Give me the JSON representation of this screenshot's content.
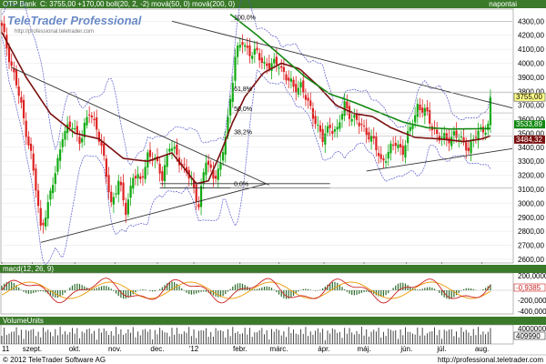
{
  "header": {
    "symbol": "OTP Bank",
    "info": "C: 3755,00 +170,00 boll(20, 2, -2) mová(50, 0) mová(200, 0)",
    "period": "napontai"
  },
  "watermark": {
    "brand": "TeleTrader Professional",
    "url": "http://professional.teletrader.com"
  },
  "footer": {
    "copyright": "© 2012 TeleTrader Software AG",
    "url": "http://professional.teletrader.com"
  },
  "colors": {
    "header_bg": "#3a7a2a",
    "panel_header_bg": "#3a7a2a",
    "bull": "#11aa11",
    "bear": "#dd2222",
    "ma50": "#7a0f0f",
    "ma200": "#118811",
    "boll": "#5555cc",
    "trend": "#333333",
    "macd": "#cc2222",
    "signal": "#ee9900",
    "hist": "#2a6a2a"
  },
  "chart_data": [
    {
      "type": "candlestick",
      "title": "OTP Bank",
      "yticks": [
        "2600,00",
        "2700,00",
        "2800,00",
        "2900,00",
        "3000,00",
        "3100,00",
        "3200,00",
        "3300,00",
        "3400,00",
        "3500,00",
        "3600,00",
        "3700,00",
        "3800,00",
        "3900,00",
        "4000,00",
        "4100,00",
        "4200,00",
        "4300,00"
      ],
      "ylim": [
        2580,
        4380
      ],
      "xticks": [
        {
          "label": "11",
          "day": 0
        },
        {
          "label": "szept.",
          "day": 25
        },
        {
          "label": "okt.",
          "day": 60
        },
        {
          "label": "nov.",
          "day": 93
        },
        {
          "label": "dec.",
          "day": 128
        },
        {
          "label": "'12",
          "day": 158
        },
        {
          "label": "febr.",
          "day": 196
        },
        {
          "label": "márc.",
          "day": 228
        },
        {
          "label": "ápr.",
          "day": 265
        },
        {
          "label": "máj.",
          "day": 298
        },
        {
          "label": "jún.",
          "day": 333
        },
        {
          "label": "júl.",
          "day": 362
        },
        {
          "label": "aug.",
          "day": 395
        }
      ],
      "xlim": [
        0,
        420
      ],
      "last_price": "3755,00",
      "ma_labels": [
        "3533,89",
        "3484,32"
      ],
      "fib_levels": [
        {
          "label": "100,0%",
          "value": 4300
        },
        {
          "label": "61,8%",
          "value": 3790
        },
        {
          "label": "50,0%",
          "value": 3645
        },
        {
          "label": "38,2%",
          "value": 3480
        },
        {
          "label": "0,0%",
          "value": 3110
        }
      ],
      "close_anchors": [
        [
          0,
          4250
        ],
        [
          6,
          4050
        ],
        [
          12,
          3850
        ],
        [
          18,
          3600
        ],
        [
          24,
          3350
        ],
        [
          28,
          3100
        ],
        [
          32,
          2820
        ],
        [
          38,
          2990
        ],
        [
          45,
          3250
        ],
        [
          50,
          3500
        ],
        [
          58,
          3550
        ],
        [
          65,
          3450
        ],
        [
          72,
          3650
        ],
        [
          78,
          3550
        ],
        [
          84,
          3300
        ],
        [
          90,
          3000
        ],
        [
          96,
          3150
        ],
        [
          102,
          2950
        ],
        [
          108,
          3200
        ],
        [
          114,
          3150
        ],
        [
          120,
          3350
        ],
        [
          126,
          3300
        ],
        [
          132,
          3200
        ],
        [
          138,
          3400
        ],
        [
          144,
          3350
        ],
        [
          150,
          3250
        ],
        [
          156,
          3150
        ],
        [
          162,
          3000
        ],
        [
          168,
          3300
        ],
        [
          174,
          3200
        ],
        [
          180,
          3250
        ],
        [
          186,
          3600
        ],
        [
          192,
          4050
        ],
        [
          198,
          4150
        ],
        [
          204,
          4080
        ],
        [
          210,
          4060
        ],
        [
          216,
          4000
        ],
        [
          222,
          3980
        ],
        [
          228,
          4000
        ],
        [
          234,
          3900
        ],
        [
          240,
          3820
        ],
        [
          246,
          3850
        ],
        [
          252,
          3700
        ],
        [
          258,
          3600
        ],
        [
          264,
          3450
        ],
        [
          270,
          3550
        ],
        [
          276,
          3520
        ],
        [
          282,
          3700
        ],
        [
          288,
          3620
        ],
        [
          294,
          3560
        ],
        [
          300,
          3520
        ],
        [
          306,
          3430
        ],
        [
          312,
          3300
        ],
        [
          318,
          3360
        ],
        [
          324,
          3430
        ],
        [
          330,
          3380
        ],
        [
          336,
          3520
        ],
        [
          342,
          3700
        ],
        [
          348,
          3650
        ],
        [
          354,
          3550
        ],
        [
          360,
          3470
        ],
        [
          366,
          3450
        ],
        [
          372,
          3500
        ],
        [
          378,
          3440
        ],
        [
          384,
          3400
        ],
        [
          390,
          3480
        ],
        [
          396,
          3530
        ],
        [
          400,
          3560
        ],
        [
          403,
          3755
        ]
      ],
      "ma50_anchors": [
        [
          0,
          4220
        ],
        [
          20,
          3900
        ],
        [
          40,
          3640
        ],
        [
          60,
          3500
        ],
        [
          80,
          3460
        ],
        [
          100,
          3320
        ],
        [
          120,
          3300
        ],
        [
          140,
          3360
        ],
        [
          160,
          3140
        ],
        [
          170,
          3160
        ],
        [
          180,
          3360
        ],
        [
          190,
          3580
        ],
        [
          200,
          3760
        ],
        [
          215,
          3930
        ],
        [
          230,
          4000
        ],
        [
          245,
          3960
        ],
        [
          260,
          3840
        ],
        [
          275,
          3700
        ],
        [
          290,
          3640
        ],
        [
          305,
          3620
        ],
        [
          320,
          3540
        ],
        [
          340,
          3470
        ],
        [
          360,
          3460
        ],
        [
          380,
          3440
        ],
        [
          395,
          3460
        ],
        [
          403,
          3484
        ]
      ],
      "ma200_anchors": [
        [
          188,
          4350
        ],
        [
          210,
          4200
        ],
        [
          230,
          4050
        ],
        [
          250,
          3900
        ],
        [
          270,
          3780
        ],
        [
          290,
          3720
        ],
        [
          310,
          3650
        ],
        [
          330,
          3580
        ],
        [
          350,
          3540
        ],
        [
          370,
          3530
        ],
        [
          390,
          3532
        ],
        [
          403,
          3534
        ]
      ],
      "trendlines": [
        {
          "from": [
            8,
            3970
          ],
          "to": [
            220,
            3130
          ]
        },
        {
          "from": [
            32,
            2720
          ],
          "to": [
            218,
            3140
          ]
        },
        {
          "from": [
            140,
            4300
          ],
          "to": [
            420,
            3680
          ]
        },
        {
          "from": [
            300,
            3230
          ],
          "to": [
            420,
            3390
          ]
        },
        {
          "from": [
            130,
            3110
          ],
          "to": [
            270,
            3110
          ]
        },
        {
          "from": [
            130,
            3140
          ],
          "to": [
            270,
            3140
          ]
        }
      ],
      "sub_panels": [
        {
          "name": "macd(12, 26, 9)",
          "value_label": "-0,9385",
          "yticks": [
            "200,0000",
            "0,0000",
            "-200,0000",
            "-400,0000"
          ]
        },
        {
          "name": "VolumeUnits",
          "value_label": "409990",
          "yticks": [
            "4000000"
          ]
        }
      ]
    }
  ]
}
